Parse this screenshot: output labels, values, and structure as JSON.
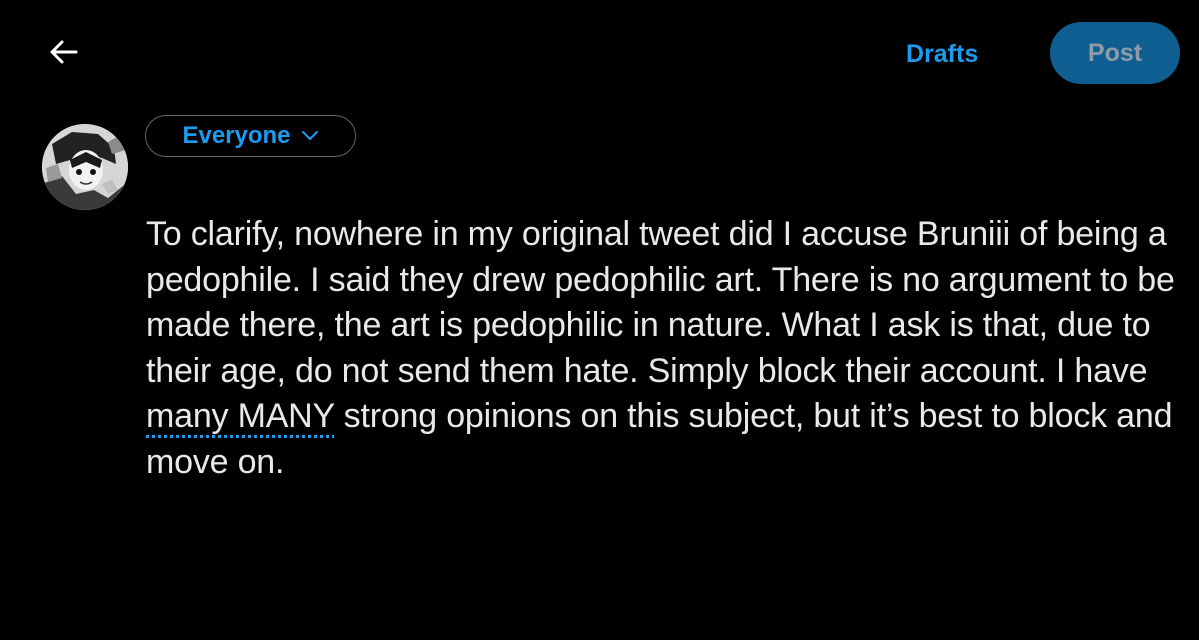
{
  "header": {
    "back_icon": "arrow-left-icon",
    "drafts_label": "Drafts",
    "post_label": "Post"
  },
  "composer": {
    "avatar_icon": "user-avatar-illustration",
    "audience_label": "Everyone",
    "audience_icon": "chevron-down-icon",
    "text_before": "To clarify, nowhere in my original tweet did I accuse Bruniii of being a pedophile. I said they drew pedophilic art. There is no argument to be made there, the art is pedophilic in nature. What I ask is that, due to their age, do not send them hate. Simply block their account. I have ",
    "text_flagged": "many MANY",
    "text_after": " strong opinions on this subject, but it’s best to block and move on."
  },
  "colors": {
    "background": "#000000",
    "text": "#e7e9ea",
    "accent": "#1d9bf0",
    "post_button_bg": "#0f5e91",
    "post_button_text": "#8f9ba6",
    "pill_border": "#5b6670"
  }
}
